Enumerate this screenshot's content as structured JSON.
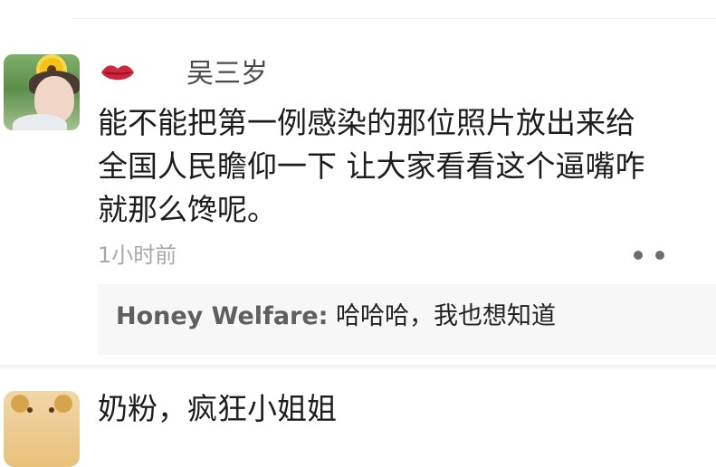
{
  "comment": {
    "username": "吴三岁",
    "lines": [
      "能不能把第一例感染的那位照片放出来给",
      "全国人民瞻仰一下 让大家看看这个逼嘴咋",
      "就那么馋呢。"
    ],
    "time": "1小时前",
    "reply": {
      "author": "Honey Welfare:",
      "text": " 哈哈哈，我也想知道"
    }
  },
  "next_comment": {
    "username": "奶粉，疯狂小姐姐"
  },
  "icons": {
    "lips": "lips-icon",
    "more": "more-icon"
  },
  "colors": {
    "username": "#4b4b4b",
    "time": "#a8a8a8",
    "reply_background": "#f7f7f7",
    "lips": "#d0263b"
  }
}
